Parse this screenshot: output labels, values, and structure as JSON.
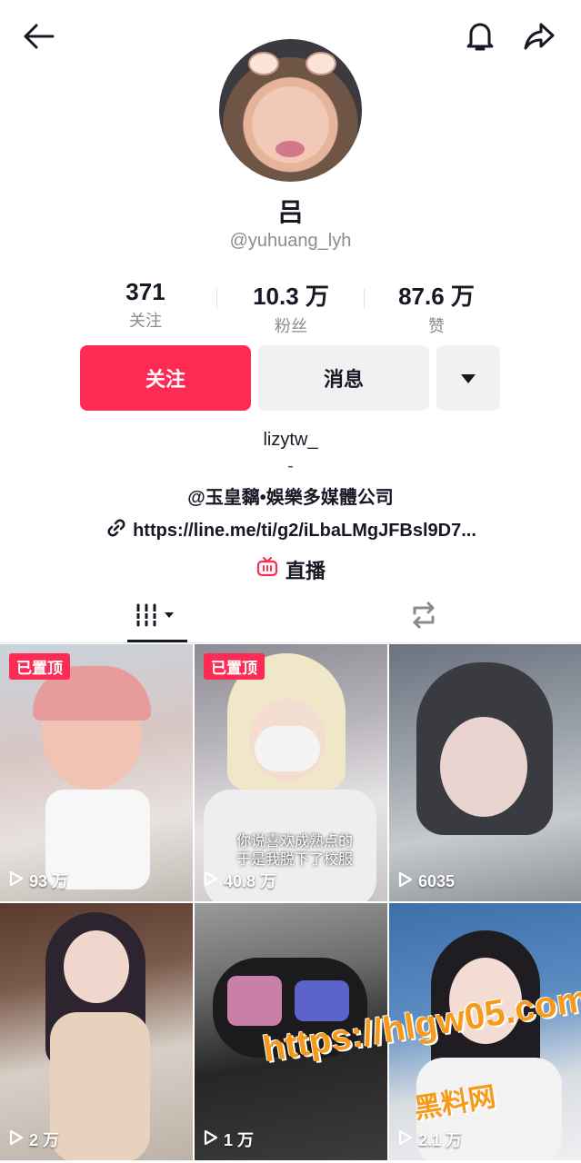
{
  "profile": {
    "name": "吕",
    "handle": "@yuhuang_lyh"
  },
  "stats": [
    {
      "value": "371",
      "label": "关注"
    },
    {
      "value": "10.3 万",
      "label": "粉丝"
    },
    {
      "value": "87.6 万",
      "label": "赞"
    }
  ],
  "actions": {
    "follow": "关注",
    "message": "消息"
  },
  "bio": {
    "line1": "lizytw_",
    "line2": "-",
    "line3": "@玉皇黐•娛樂多媒體公司",
    "link": "https://line.me/ti/g2/iLbaLMgJFBsl9D7...",
    "live": "直播"
  },
  "colors": {
    "accent": "#fe2c55",
    "watermark": "#f59a1a"
  },
  "videos": [
    {
      "pinned": "已置顶",
      "views": "93 万"
    },
    {
      "pinned": "已置顶",
      "views": "40.8 万",
      "caption1": "你说喜欢成熟点的",
      "caption2": "于是我脱下了校服"
    },
    {
      "views": "6035"
    },
    {
      "views": "2 万"
    },
    {
      "views": "1 万"
    },
    {
      "views": "2.1 万"
    }
  ],
  "watermark": {
    "url": "https://hlgw05.com",
    "text": "黑料网"
  }
}
